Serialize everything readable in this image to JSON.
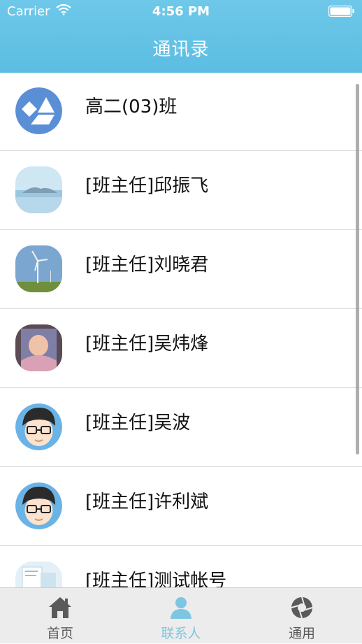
{
  "status_bar": {
    "carrier": "Carrier",
    "time": "4:56 PM"
  },
  "nav": {
    "title": "通讯录"
  },
  "contacts": [
    {
      "name": "高二(03)班",
      "avatar_icon": "class-group-icon"
    },
    {
      "name": "[班主任]邱振飞",
      "avatar_icon": "mountain-photo-avatar"
    },
    {
      "name": "[班主任]刘晓君",
      "avatar_icon": "wind-turbine-photo-avatar"
    },
    {
      "name": "[班主任]吴炜烽",
      "avatar_icon": "baby-photo-avatar"
    },
    {
      "name": "[班主任]吴波",
      "avatar_icon": "cartoon-boy-avatar"
    },
    {
      "name": "[班主任]许利斌",
      "avatar_icon": "cartoon-boy-avatar"
    },
    {
      "name": "[班主任]测试帐号",
      "avatar_icon": "document-photo-avatar"
    }
  ],
  "tabs": [
    {
      "label": "首页",
      "icon": "home-icon"
    },
    {
      "label": "联系人",
      "icon": "contacts-icon"
    },
    {
      "label": "通用",
      "icon": "settings-icon"
    }
  ],
  "colors": {
    "header": "#5cbde2",
    "tab_active": "#7cc6e2",
    "tab_inactive": "#5a5a5a",
    "tabbar_bg": "#ececec"
  }
}
